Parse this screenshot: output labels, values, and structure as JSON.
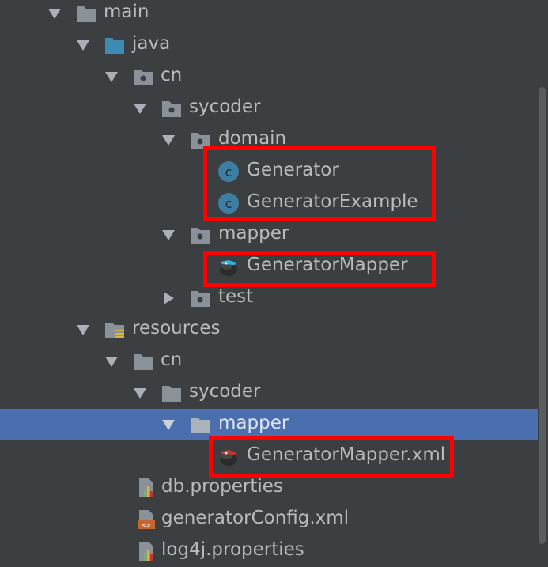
{
  "tree": {
    "items": [
      {
        "label": "main"
      },
      {
        "label": "java"
      },
      {
        "label": "cn"
      },
      {
        "label": "sycoder"
      },
      {
        "label": "domain"
      },
      {
        "label": "Generator"
      },
      {
        "label": "GeneratorExample"
      },
      {
        "label": "mapper"
      },
      {
        "label": "GeneratorMapper"
      },
      {
        "label": "test"
      },
      {
        "label": "resources"
      },
      {
        "label": "cn"
      },
      {
        "label": "sycoder"
      },
      {
        "label": "mapper"
      },
      {
        "label": "GeneratorMapper.xml"
      },
      {
        "label": "db.properties"
      },
      {
        "label": "generatorConfig.xml"
      },
      {
        "label": "log4j.properties"
      }
    ],
    "selected_item": "mapper"
  },
  "colors": {
    "background": "#3c3f41",
    "selection": "#4b6eaf",
    "folder": "#8a9199",
    "source_folder": "#3d8ab3",
    "highlight_box": "#ff0000",
    "class_icon": "#3d7fa3"
  }
}
